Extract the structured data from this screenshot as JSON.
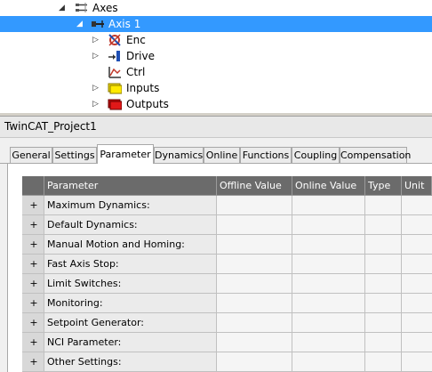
{
  "tree": {
    "items": [
      {
        "label": "Axes",
        "expander": "◢",
        "icon": "axes-icon"
      },
      {
        "label": "Axis 1",
        "expander": "◢",
        "icon": "axis-icon"
      },
      {
        "label": "Enc",
        "expander": "▷",
        "icon": "encoder-icon"
      },
      {
        "label": "Drive",
        "expander": "▷",
        "icon": "drive-icon"
      },
      {
        "label": "Ctrl",
        "expander": "",
        "icon": "controller-icon"
      },
      {
        "label": "Inputs",
        "expander": "▷",
        "icon": "inputs-icon"
      },
      {
        "label": "Outputs",
        "expander": "▷",
        "icon": "outputs-icon"
      }
    ]
  },
  "project": {
    "title": "TwinCAT_Project1"
  },
  "tabs": [
    {
      "label": "General"
    },
    {
      "label": "Settings"
    },
    {
      "label": "Parameter"
    },
    {
      "label": "Dynamics"
    },
    {
      "label": "Online"
    },
    {
      "label": "Functions"
    },
    {
      "label": "Coupling"
    },
    {
      "label": "Compensation"
    }
  ],
  "grid": {
    "columns": [
      "Parameter",
      "Offline Value",
      "Online Value",
      "Type",
      "Unit"
    ],
    "expand_symbol": "+",
    "rows": [
      {
        "name": "Maximum Dynamics:"
      },
      {
        "name": "Default Dynamics:"
      },
      {
        "name": "Manual Motion and Homing:"
      },
      {
        "name": "Fast Axis Stop:"
      },
      {
        "name": "Limit Switches:"
      },
      {
        "name": "Monitoring:"
      },
      {
        "name": "Setpoint Generator:"
      },
      {
        "name": "NCI Parameter:"
      },
      {
        "name": "Other Settings:"
      }
    ]
  },
  "colors": {
    "selection": "#3399ff",
    "header": "#6b6b6b"
  }
}
